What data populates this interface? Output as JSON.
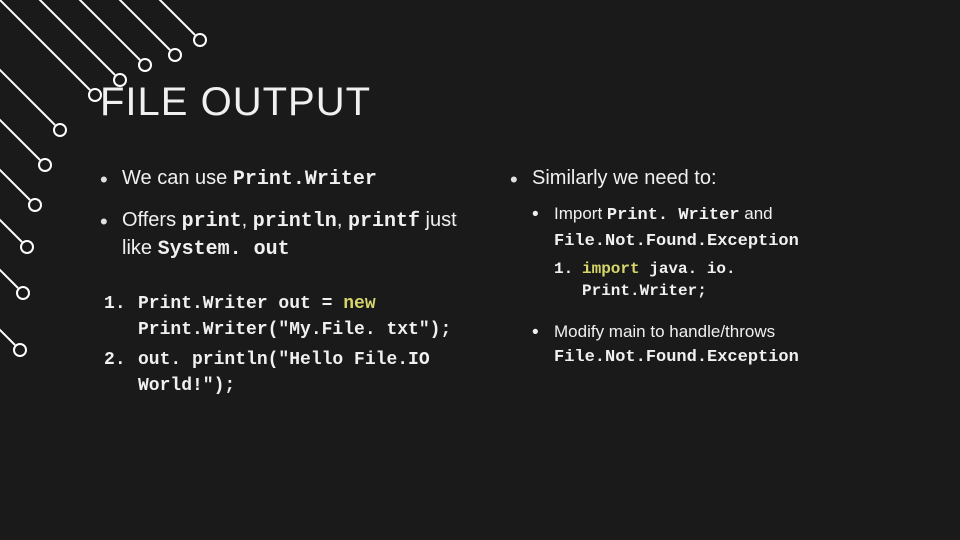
{
  "title": "FILE OUTPUT",
  "left": {
    "b1_pre": "We can use ",
    "b1_code": "Print.Writer",
    "b2_pre": "Offers ",
    "b2_code1": "print",
    "b2_mid1": ", ",
    "b2_code2": "println",
    "b2_mid2": ", ",
    "b2_code3": "printf",
    "b2_mid3": " just like ",
    "b2_code4": "System. out",
    "code1_a": "Print.Writer out = ",
    "code1_new": "new",
    "code1_b": " Print.Writer(\"My.File. txt\");",
    "code2": "out. println(\"Hello File.IO World!\");"
  },
  "right": {
    "b1": "Similarly we need to:",
    "s1_pre": "Import ",
    "s1_code1": "Print. Writer",
    "s1_mid": " and ",
    "s1_code2": "File.Not.Found.Exception",
    "s1_import": "import",
    "s1_importline": " java. io. Print.Writer;",
    "s2_pre": "Modify main to handle/throws ",
    "s2_code": "File.Not.Found.Exception"
  }
}
